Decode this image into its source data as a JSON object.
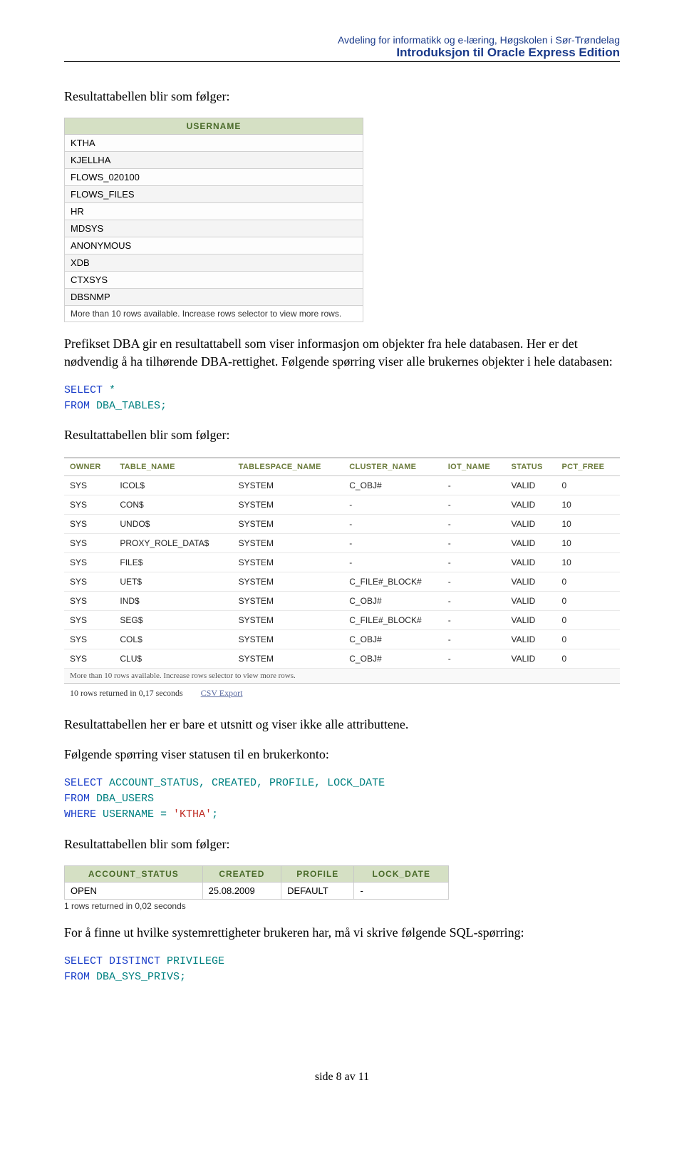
{
  "header": {
    "line1": "Avdeling for informatikk og e-læring, Høgskolen i Sør-Trøndelag",
    "line2": "Introduksjon til Oracle Express Edition"
  },
  "p1": "Resultattabellen blir som følger:",
  "table1": {
    "header": "USERNAME",
    "rows": [
      "KTHA",
      "KJELLHA",
      "FLOWS_020100",
      "FLOWS_FILES",
      "HR",
      "MDSYS",
      "ANONYMOUS",
      "XDB",
      "CTXSYS",
      "DBSNMP"
    ],
    "note": "More than 10 rows available. Increase rows selector to view more rows."
  },
  "p2": "Prefikset DBA gir en resultattabell som viser informasjon om objekter fra hele databasen. Her er det nødvendig å ha tilhørende DBA-rettighet. Følgende spørring viser alle brukernes objekter i hele databasen:",
  "code1": {
    "select": "SELECT",
    "star": " *",
    "from": "FROM",
    "tbl": " DBA_TABLES;"
  },
  "p3": "Resultattabellen blir som følger:",
  "shot": {
    "headers": [
      "OWNER",
      "TABLE_NAME",
      "TABLESPACE_NAME",
      "CLUSTER_NAME",
      "IOT_NAME",
      "STATUS",
      "PCT_FREE"
    ],
    "rows": [
      [
        "SYS",
        "ICOL$",
        "SYSTEM",
        "C_OBJ#",
        "-",
        "VALID",
        "0"
      ],
      [
        "SYS",
        "CON$",
        "SYSTEM",
        "-",
        "-",
        "VALID",
        "10"
      ],
      [
        "SYS",
        "UNDO$",
        "SYSTEM",
        "-",
        "-",
        "VALID",
        "10"
      ],
      [
        "SYS",
        "PROXY_ROLE_DATA$",
        "SYSTEM",
        "-",
        "-",
        "VALID",
        "10"
      ],
      [
        "SYS",
        "FILE$",
        "SYSTEM",
        "-",
        "-",
        "VALID",
        "10"
      ],
      [
        "SYS",
        "UET$",
        "SYSTEM",
        "C_FILE#_BLOCK#",
        "-",
        "VALID",
        "0"
      ],
      [
        "SYS",
        "IND$",
        "SYSTEM",
        "C_OBJ#",
        "-",
        "VALID",
        "0"
      ],
      [
        "SYS",
        "SEG$",
        "SYSTEM",
        "C_FILE#_BLOCK#",
        "-",
        "VALID",
        "0"
      ],
      [
        "SYS",
        "COL$",
        "SYSTEM",
        "C_OBJ#",
        "-",
        "VALID",
        "0"
      ],
      [
        "SYS",
        "CLU$",
        "SYSTEM",
        "C_OBJ#",
        "-",
        "VALID",
        "0"
      ]
    ],
    "note1": "More than 10 rows available. Increase rows selector to view more rows.",
    "note2": "10 rows returned in 0,17 seconds",
    "csv": "CSV Export"
  },
  "p4": "Resultattabellen her er bare et utsnitt og viser ikke alle attributtene.",
  "p5": "Følgende spørring viser statusen til en brukerkonto:",
  "code2": {
    "l1": {
      "select": "SELECT",
      "rest": " ACCOUNT_STATUS, CREATED, PROFILE, LOCK_DATE"
    },
    "l2": {
      "from": "FROM",
      "rest": " DBA_USERS"
    },
    "l3": {
      "where": "WHERE",
      "mid": " USERNAME = ",
      "val": "'KTHA'",
      "semi": ";"
    }
  },
  "p6": "Resultattabellen blir som følger:",
  "table3": {
    "headers": [
      "ACCOUNT_STATUS",
      "CREATED",
      "PROFILE",
      "LOCK_DATE"
    ],
    "row": [
      "OPEN",
      "25.08.2009",
      "DEFAULT",
      "-"
    ],
    "note": "1 rows returned in 0,02 seconds"
  },
  "p7": "For å finne ut hvilke systemrettigheter brukeren har, må vi skrive følgende SQL-spørring:",
  "code3": {
    "l1": {
      "a": "SELECT",
      "b": " DISTINCT",
      "c": " PRIVILEGE"
    },
    "l2": {
      "a": "FROM",
      "b": " DBA_SYS_PRIVS;"
    }
  },
  "footer": "side 8 av 11"
}
